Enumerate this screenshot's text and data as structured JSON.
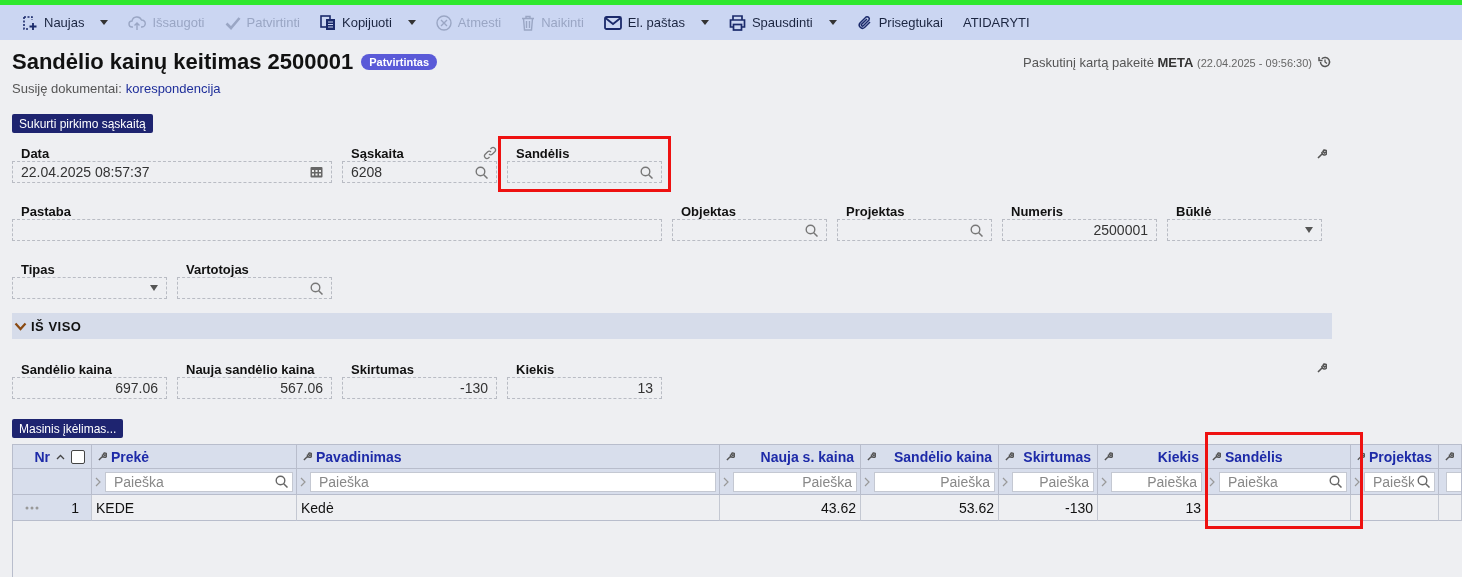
{
  "toolbar": [
    {
      "kind": "new",
      "label": "Naujas",
      "disabled": false,
      "dropdown": true
    },
    {
      "kind": "save",
      "label": "Išsaugoti",
      "disabled": true,
      "dropdown": false
    },
    {
      "kind": "confirm",
      "label": "Patvirtinti",
      "disabled": true,
      "dropdown": false
    },
    {
      "kind": "copy",
      "label": "Kopijuoti",
      "disabled": false,
      "dropdown": true
    },
    {
      "kind": "discard",
      "label": "Atmesti",
      "disabled": true,
      "dropdown": false
    },
    {
      "kind": "delete",
      "label": "Naikinti",
      "disabled": true,
      "dropdown": false
    },
    {
      "kind": "email",
      "label": "El. paštas",
      "disabled": false,
      "dropdown": true
    },
    {
      "kind": "print",
      "label": "Spausdinti",
      "disabled": false,
      "dropdown": true
    },
    {
      "kind": "attach",
      "label": "Prisegtukai",
      "disabled": false,
      "dropdown": false
    },
    {
      "kind": "text",
      "label": "ATIDARYTI",
      "disabled": false,
      "dropdown": false
    }
  ],
  "header": {
    "title": "Sandėlio kainų keitimas 2500001",
    "status": "Patvirtintas",
    "changed_prefix": "Paskutinį kartą pakeitė",
    "changed_user": "META",
    "changed_time": "(22.04.2025 - 09:56:30)"
  },
  "related": {
    "label": "Susiję dokumentai:",
    "link": "korespondencija"
  },
  "action_button": "Sukurti pirkimo sąskaitą",
  "fields": [
    [
      {
        "label": "Data",
        "value": "22.04.2025 08:57:37",
        "kind": "date",
        "link": false,
        "highlighted": false
      },
      {
        "label": "Sąskaita",
        "value": "6208",
        "kind": "search",
        "link": true,
        "highlighted": false
      },
      {
        "label": "Sandėlis",
        "kind": "search",
        "link": false,
        "highlighted": true
      }
    ],
    [
      {
        "label": "Pastaba",
        "kind": "text",
        "link": false,
        "highlighted": false
      },
      {
        "label": "Objektas",
        "kind": "search",
        "link": false,
        "highlighted": false
      },
      {
        "label": "Projektas",
        "kind": "search",
        "link": false,
        "highlighted": false
      },
      {
        "label": "Numeris",
        "value": "2500001",
        "kind": "number",
        "link": false,
        "highlighted": false
      },
      {
        "label": "Būklė",
        "kind": "select",
        "link": false,
        "highlighted": false
      }
    ],
    [
      {
        "label": "Tipas",
        "kind": "select",
        "link": false,
        "highlighted": false
      },
      {
        "label": "Vartotojas",
        "kind": "search",
        "link": false,
        "highlighted": false
      }
    ]
  ],
  "section": {
    "title": "IŠ VISO",
    "expanded": true
  },
  "totals": [
    {
      "label": "Sandėlio kaina",
      "value": "697.06"
    },
    {
      "label": "Nauja sandėlio kaina",
      "value": "567.06"
    },
    {
      "label": "Skirtumas",
      "value": "-130"
    },
    {
      "label": "Kiekis",
      "value": "13"
    }
  ],
  "table_button": "Masinis įkėlimas...",
  "table": {
    "select_all_checked": false,
    "columns": [
      {
        "label": "Nr"
      },
      {
        "label": "Prekė",
        "kind": "text",
        "placeholder": "Paieška",
        "search": true,
        "highlighted": false
      },
      {
        "label": "Pavadinimas",
        "kind": "text",
        "placeholder": "Paieška",
        "search": false,
        "highlighted": false
      },
      {
        "label": "Nauja s. kaina",
        "kind": "number",
        "placeholder": "Paieška",
        "search": false,
        "highlighted": false
      },
      {
        "label": "Sandėlio kaina",
        "kind": "number",
        "placeholder": "Paieška",
        "search": false,
        "highlighted": false
      },
      {
        "label": "Skirtumas",
        "kind": "number",
        "placeholder": "Paieška",
        "search": false,
        "highlighted": false
      },
      {
        "label": "Kiekis",
        "kind": "number",
        "placeholder": "Paieška",
        "search": false,
        "highlighted": false
      },
      {
        "label": "Sandėlis",
        "kind": "text",
        "placeholder": "Paieška",
        "search": true,
        "highlighted": true
      },
      {
        "label": "Projektas",
        "kind": "text",
        "placeholder": "Paiešk",
        "search": true,
        "highlighted": false
      }
    ],
    "rows": [
      {
        "cells": [
          "1",
          "KEDE",
          "Kedė",
          "43.62",
          "53.62",
          "-130",
          "13"
        ]
      }
    ]
  }
}
